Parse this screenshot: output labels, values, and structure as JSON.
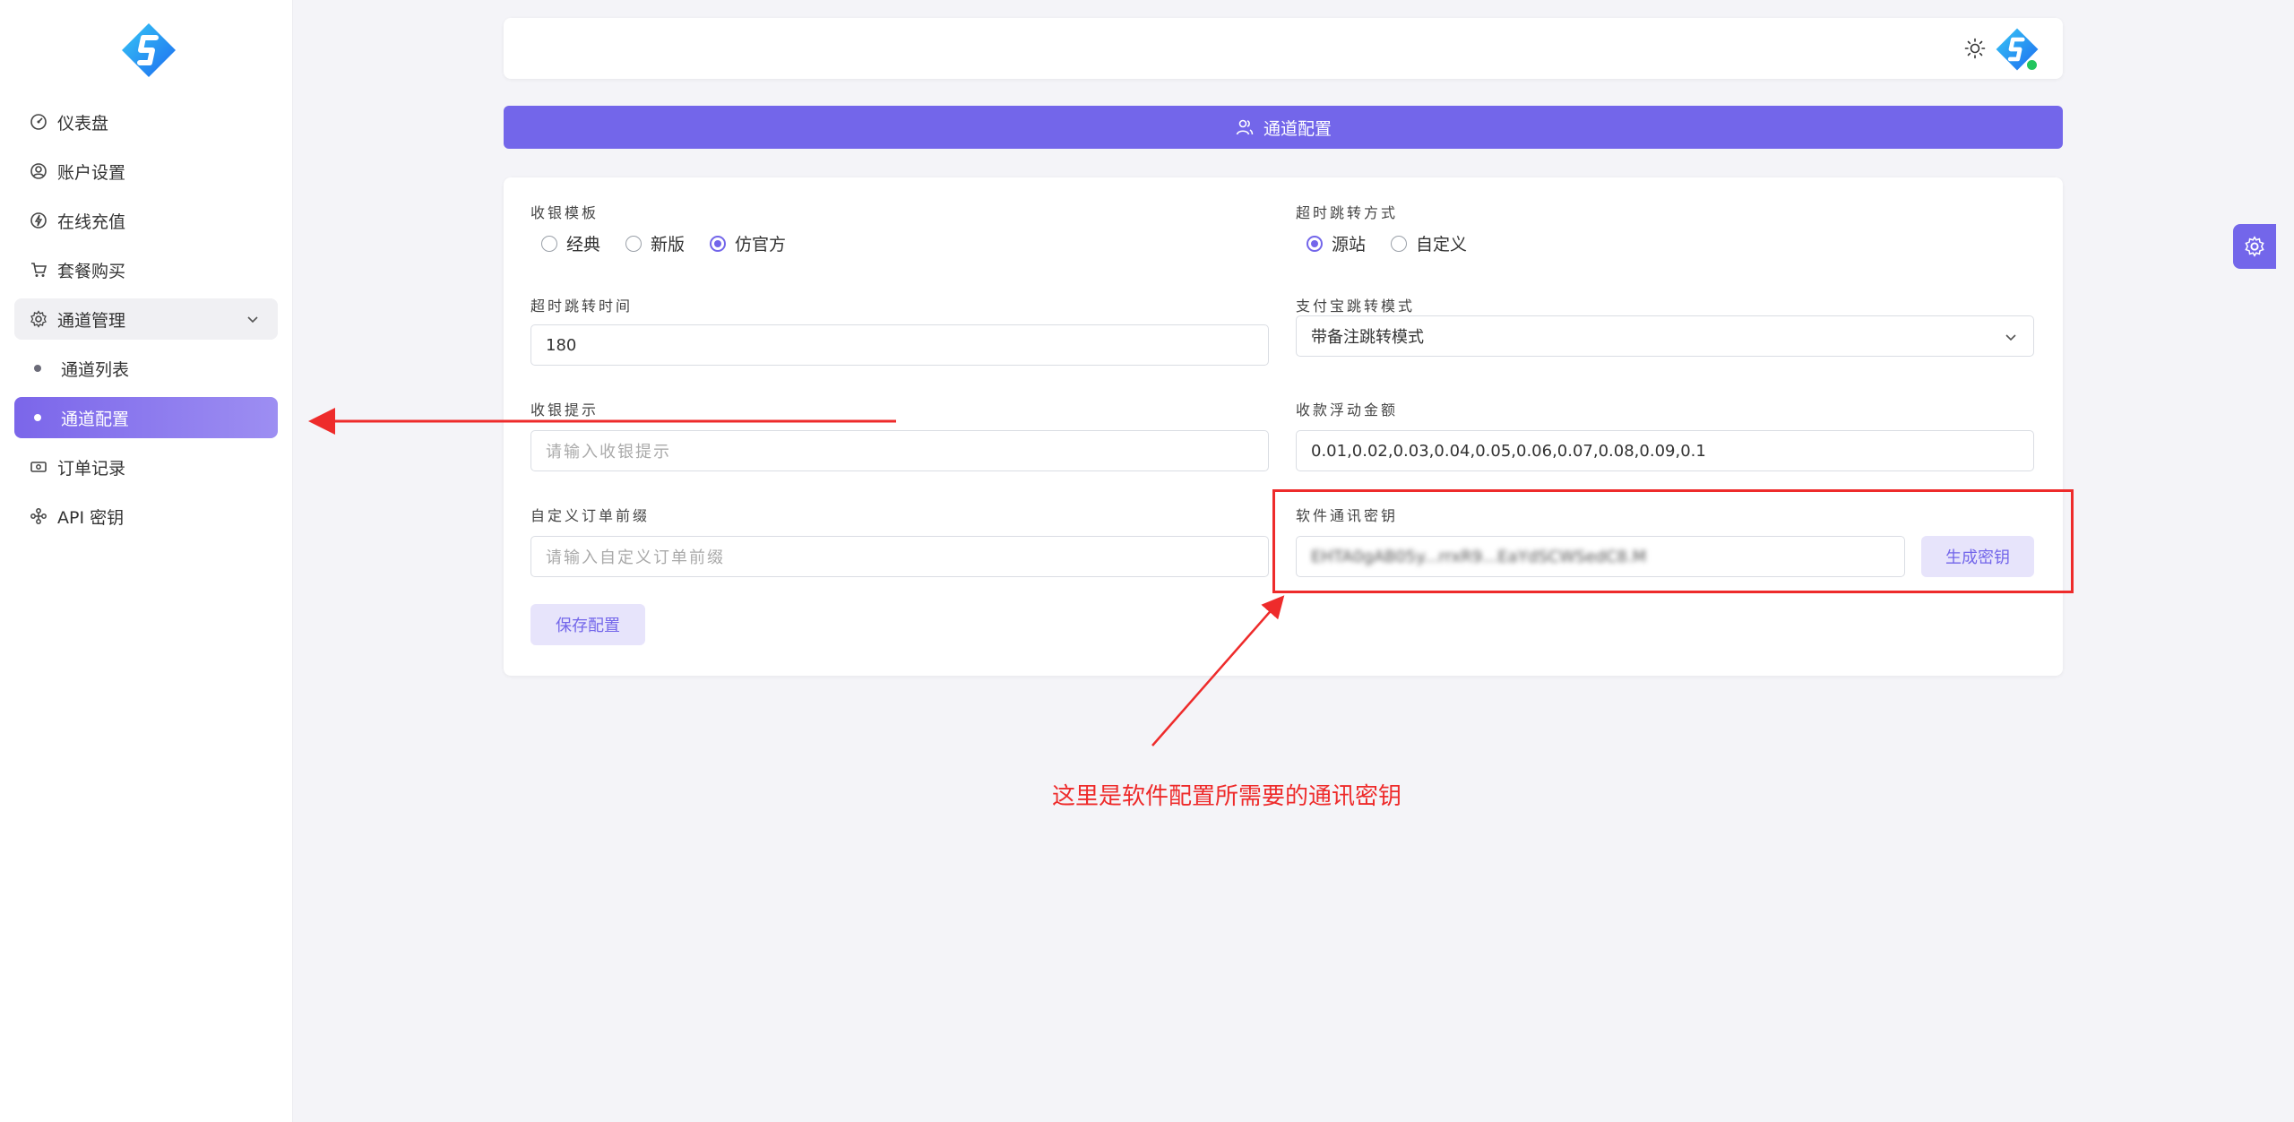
{
  "sidebar": {
    "items": [
      {
        "label": "仪表盘"
      },
      {
        "label": "账户设置"
      },
      {
        "label": "在线充值"
      },
      {
        "label": "套餐购买"
      },
      {
        "label": "通道管理"
      },
      {
        "label": "通道列表"
      },
      {
        "label": "通道配置"
      },
      {
        "label": "订单记录"
      },
      {
        "label": "API 密钥"
      }
    ]
  },
  "header": {
    "title": "通道配置"
  },
  "form": {
    "cashier_template": {
      "label": "收银模板",
      "options": [
        "经典",
        "新版",
        "仿官方"
      ],
      "selected": "仿官方"
    },
    "timeout_redirect_method": {
      "label": "超时跳转方式",
      "options": [
        "源站",
        "自定义"
      ],
      "selected": "源站"
    },
    "timeout_redirect_time": {
      "label": "超时跳转时间",
      "value": "180"
    },
    "alipay_redirect_mode": {
      "label": "支付宝跳转模式",
      "value": "带备注跳转模式"
    },
    "cashier_tip": {
      "label": "收银提示",
      "placeholder": "请输入收银提示"
    },
    "float_amount": {
      "label": "收款浮动金额",
      "value": "0.01,0.02,0.03,0.04,0.05,0.06,0.07,0.08,0.09,0.1"
    },
    "order_prefix": {
      "label": "自定义订单前缀",
      "placeholder": "请输入自定义订单前缀"
    },
    "software_key": {
      "label": "软件通讯密钥",
      "value": "EHTA0gAB05y...rrxR9...EaYdSCWSedC8.M",
      "generate_label": "生成密钥"
    },
    "save_label": "保存配置"
  },
  "annotation": {
    "text": "这里是软件配置所需要的通讯密钥",
    "color": "#ee2b2b"
  },
  "colors": {
    "accent": "#7366ea",
    "online": "#22c55e"
  }
}
